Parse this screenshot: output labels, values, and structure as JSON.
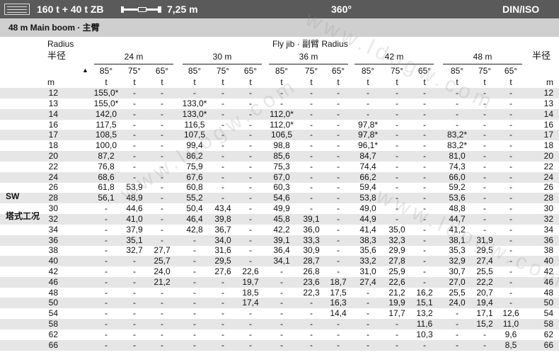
{
  "header": {
    "capacity": "160 t + 40 t ZB",
    "counterweight": "7,25 m",
    "slew": "360°",
    "standard": "DIN/ISO",
    "icons": [
      "crane-logo-icon",
      "jib-length-icon"
    ]
  },
  "subheader": {
    "title": "48 m   Main boom · 主臂"
  },
  "columns": {
    "radius_en": "Radius",
    "radius_cn": "半径",
    "right_label_cn": "半径",
    "flyjib_title": "Fly jib · 副臂 Radius",
    "jib_lengths": [
      "24 m",
      "30 m",
      "36 m",
      "42 m",
      "48 m"
    ],
    "angles": [
      "85°",
      "75°",
      "65°",
      "85°",
      "75°",
      "65°",
      "85°",
      "75°",
      "65°",
      "85°",
      "75°",
      "65°",
      "85°",
      "75°",
      "65°"
    ],
    "unit_radius": "m",
    "unit_load": "t",
    "right_unit": "m"
  },
  "side_labels": {
    "sw": "SW",
    "tower": "塔式工况"
  },
  "watermark": "www.ldogw.com",
  "rows": [
    {
      "r": "12",
      "v": [
        "155,0*",
        "-",
        "-",
        "-",
        "-",
        "-",
        "-",
        "-",
        "-",
        "-",
        "-",
        "-",
        "-",
        "-",
        "-"
      ]
    },
    {
      "r": "13",
      "v": [
        "155,0*",
        "-",
        "-",
        "133,0*",
        "-",
        "-",
        "-",
        "-",
        "-",
        "-",
        "-",
        "-",
        "-",
        "-",
        "-"
      ]
    },
    {
      "r": "14",
      "v": [
        "142,0",
        "-",
        "-",
        "133,0*",
        "-",
        "-",
        "112,0*",
        "-",
        "-",
        "-",
        "-",
        "-",
        "-",
        "-",
        "-"
      ]
    },
    {
      "r": "16",
      "v": [
        "117,5",
        "-",
        "-",
        "116,5",
        "-",
        "-",
        "112,0*",
        "-",
        "-",
        "97,8*",
        "-",
        "-",
        "-",
        "-",
        "-"
      ]
    },
    {
      "r": "17",
      "v": [
        "108,5",
        "-",
        "-",
        "107,5",
        "-",
        "-",
        "106,5",
        "-",
        "-",
        "97,8*",
        "-",
        "-",
        "83,2*",
        "-",
        "-"
      ]
    },
    {
      "r": "18",
      "v": [
        "100,0",
        "-",
        "-",
        "99,4",
        "-",
        "-",
        "98,8",
        "-",
        "-",
        "96,1*",
        "-",
        "-",
        "83,2*",
        "-",
        "-"
      ]
    },
    {
      "r": "20",
      "v": [
        "87,2",
        "-",
        "-",
        "86,2",
        "-",
        "-",
        "85,6",
        "-",
        "-",
        "84,7",
        "-",
        "-",
        "81,0",
        "-",
        "-"
      ]
    },
    {
      "r": "22",
      "v": [
        "76,8",
        "-",
        "-",
        "75,9",
        "-",
        "-",
        "75,3",
        "-",
        "-",
        "74,4",
        "-",
        "-",
        "74,3",
        "-",
        "-"
      ]
    },
    {
      "r": "24",
      "v": [
        "68,6",
        "-",
        "-",
        "67,6",
        "-",
        "-",
        "67,0",
        "-",
        "-",
        "66,2",
        "-",
        "-",
        "66,0",
        "-",
        "-"
      ]
    },
    {
      "r": "26",
      "v": [
        "61,8",
        "53,9",
        "-",
        "60,8",
        "-",
        "-",
        "60,3",
        "-",
        "-",
        "59,4",
        "-",
        "-",
        "59,2",
        "-",
        "-"
      ]
    },
    {
      "r": "28",
      "v": [
        "56,1",
        "48,9",
        "-",
        "55,2",
        "-",
        "-",
        "54,6",
        "-",
        "-",
        "53,8",
        "-",
        "-",
        "53,6",
        "-",
        "-"
      ]
    },
    {
      "r": "30",
      "v": [
        "-",
        "44,6",
        "-",
        "50,4",
        "43,4",
        "-",
        "49,9",
        "-",
        "-",
        "49,0",
        "-",
        "-",
        "48,8",
        "-",
        "-"
      ]
    },
    {
      "r": "32",
      "v": [
        "-",
        "41,0",
        "-",
        "46,4",
        "39,8",
        "-",
        "45,8",
        "39,1",
        "-",
        "44,9",
        "-",
        "-",
        "44,7",
        "-",
        "-"
      ]
    },
    {
      "r": "34",
      "v": [
        "-",
        "37,9",
        "-",
        "42,8",
        "36,7",
        "-",
        "42,2",
        "36,0",
        "-",
        "41,4",
        "35,0",
        "-",
        "41,2",
        "-",
        "-"
      ]
    },
    {
      "r": "36",
      "v": [
        "-",
        "35,1",
        "-",
        "-",
        "34,0",
        "-",
        "39,1",
        "33,3",
        "-",
        "38,3",
        "32,3",
        "-",
        "38,1",
        "31,9",
        "-"
      ]
    },
    {
      "r": "38",
      "v": [
        "-",
        "32,7",
        "27,7",
        "-",
        "31,6",
        "-",
        "36,4",
        "30,9",
        "-",
        "35,6",
        "29,9",
        "-",
        "35,3",
        "29,5",
        "-"
      ]
    },
    {
      "r": "40",
      "v": [
        "-",
        "-",
        "25,7",
        "-",
        "29,5",
        "-",
        "34,1",
        "28,7",
        "-",
        "33,2",
        "27,8",
        "-",
        "32,9",
        "27,4",
        "-"
      ]
    },
    {
      "r": "42",
      "v": [
        "-",
        "-",
        "24,0",
        "-",
        "27,6",
        "22,6",
        "-",
        "26,8",
        "-",
        "31,0",
        "25,9",
        "-",
        "30,7",
        "25,5",
        "-"
      ]
    },
    {
      "r": "46",
      "v": [
        "-",
        "-",
        "21,2",
        "-",
        "-",
        "19,7",
        "-",
        "23,6",
        "18,7",
        "27,4",
        "22,6",
        "-",
        "27,0",
        "22,2",
        "-"
      ]
    },
    {
      "r": "48",
      "v": [
        "-",
        "-",
        "-",
        "-",
        "-",
        "18,5",
        "-",
        "22,3",
        "17,5",
        "-",
        "21,2",
        "16,2",
        "25,5",
        "20,7",
        "-"
      ]
    },
    {
      "r": "50",
      "v": [
        "-",
        "-",
        "-",
        "-",
        "-",
        "17,4",
        "-",
        "-",
        "16,3",
        "-",
        "19,9",
        "15,1",
        "24,0",
        "19,4",
        "-"
      ]
    },
    {
      "r": "54",
      "v": [
        "-",
        "-",
        "-",
        "-",
        "-",
        "-",
        "-",
        "-",
        "14,4",
        "-",
        "17,7",
        "13,2",
        "-",
        "17,1",
        "12,6"
      ]
    },
    {
      "r": "58",
      "v": [
        "-",
        "-",
        "-",
        "-",
        "-",
        "-",
        "-",
        "-",
        "-",
        "-",
        "-",
        "11,6",
        "-",
        "15,2",
        "11,0"
      ]
    },
    {
      "r": "62",
      "v": [
        "-",
        "-",
        "-",
        "-",
        "-",
        "-",
        "-",
        "-",
        "-",
        "-",
        "-",
        "10,3",
        "-",
        "-",
        "9,6"
      ]
    },
    {
      "r": "66",
      "v": [
        "-",
        "-",
        "-",
        "-",
        "-",
        "-",
        "-",
        "-",
        "-",
        "-",
        "-",
        "-",
        "-",
        "-",
        "8,5"
      ]
    }
  ]
}
